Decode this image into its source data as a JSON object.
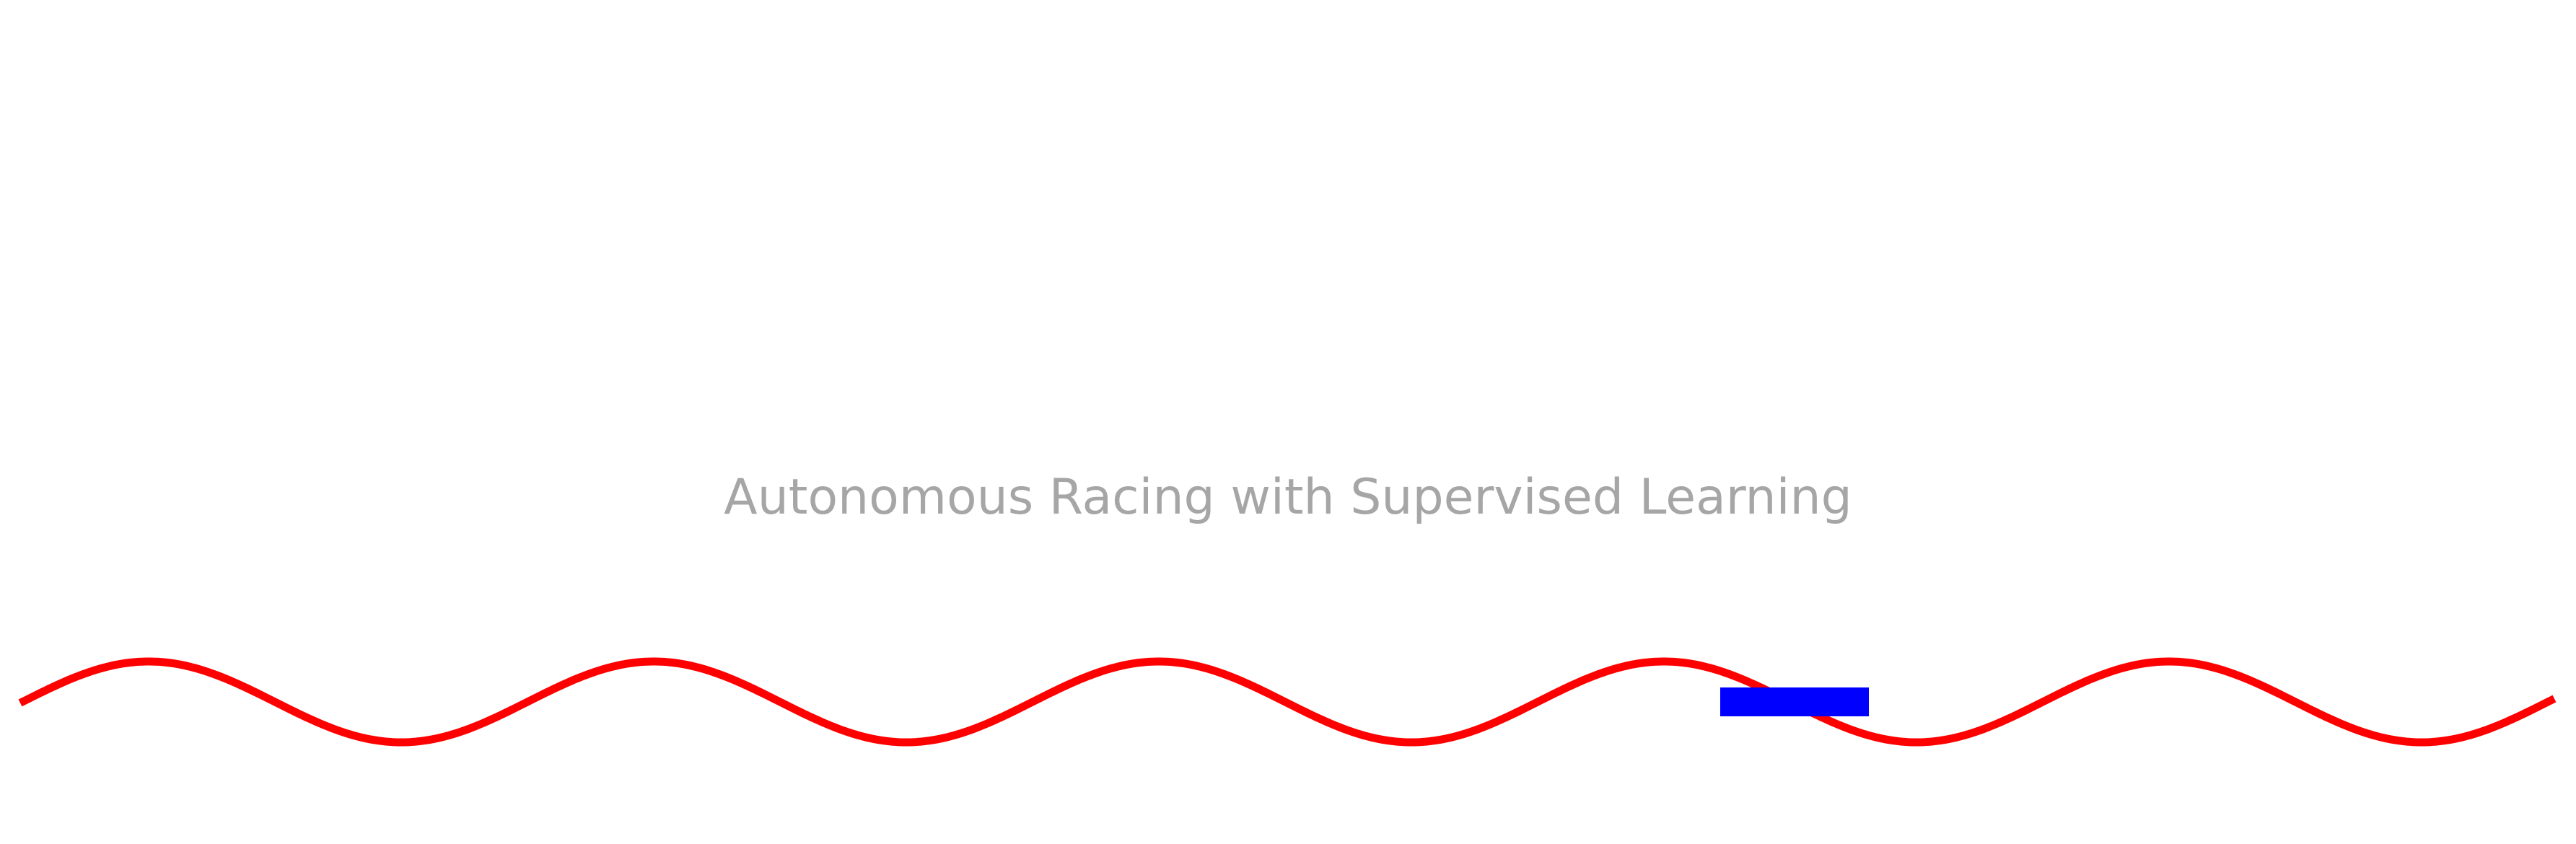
{
  "game": {
    "title": "Autonomous Racing with Supervised Learning",
    "title_color": "#a6a6a6",
    "background_color": "#ffffff",
    "track": {
      "color": "#ff0000",
      "shape": "sine-wave"
    },
    "car": {
      "color": "#0000ff",
      "shape": "rectangle"
    }
  }
}
